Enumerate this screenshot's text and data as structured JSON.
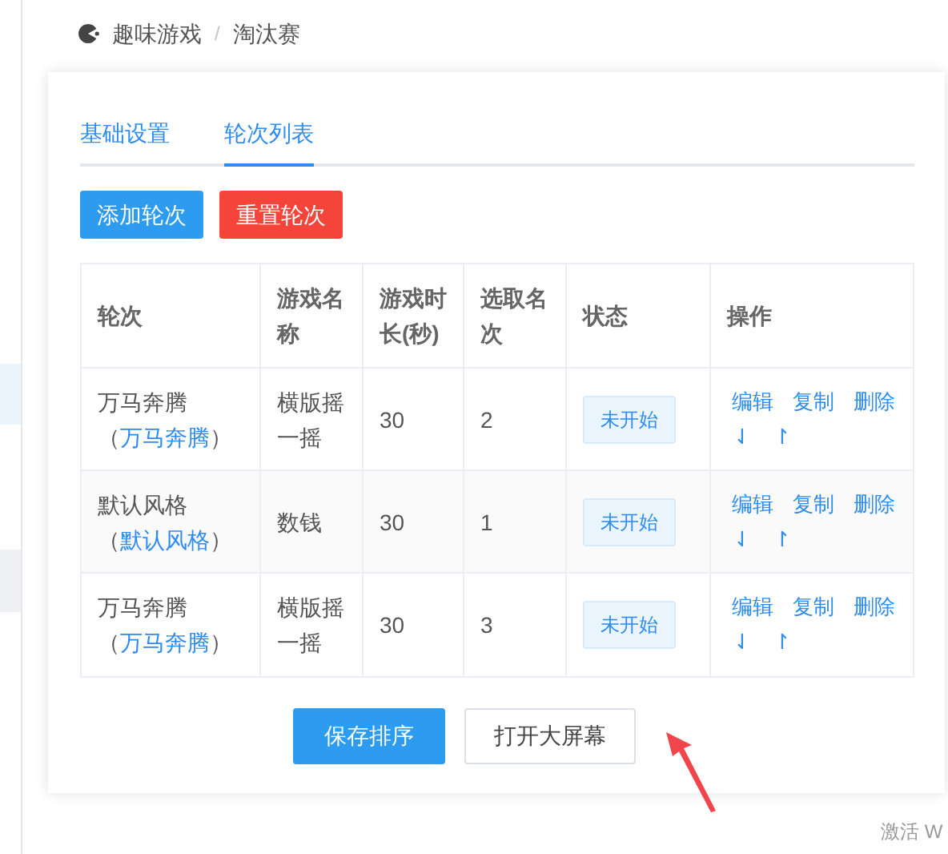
{
  "breadcrumb": [
    "趣味游戏",
    "淘汰赛"
  ],
  "breadcrumb_separator": "/",
  "tabs": [
    {
      "label": "基础设置",
      "selected": false
    },
    {
      "label": "轮次列表",
      "selected": true
    }
  ],
  "toolbar": [
    {
      "label": "添加轮次",
      "kind": "primary"
    },
    {
      "label": "重置轮次",
      "kind": "danger"
    }
  ],
  "table": {
    "columns": [
      "轮次",
      "游戏名称",
      "游戏时长(秒)",
      "选取名次",
      "状态",
      "操作"
    ],
    "rows": [
      {
        "round": {
          "text": "万马奔腾",
          "open": "（",
          "link": "万马奔腾",
          "close": "）"
        },
        "game": "横版摇一摇",
        "duration": "30",
        "rank": "2",
        "status": "未开始",
        "actions": [
          "编辑",
          "复制",
          "删除",
          "⇃",
          "↾"
        ]
      },
      {
        "round": {
          "text": "默认风格",
          "open": "（",
          "link": "默认风格",
          "close": "）"
        },
        "game": "数钱",
        "duration": "30",
        "rank": "1",
        "status": "未开始",
        "actions": [
          "编辑",
          "复制",
          "删除",
          "⇃",
          "↾"
        ]
      },
      {
        "round": {
          "text": "万马奔腾",
          "open": "（",
          "link": "万马奔腾",
          "close": "）"
        },
        "game": "横版摇一摇",
        "duration": "30",
        "rank": "3",
        "status": "未开始",
        "actions": [
          "编辑",
          "复制",
          "删除",
          "⇃",
          "↾"
        ]
      }
    ]
  },
  "footer_buttons": [
    {
      "label": "保存排序",
      "kind": "primary"
    },
    {
      "label": "打开大屏幕",
      "kind": "default"
    }
  ],
  "os_notice": "激活 W"
}
